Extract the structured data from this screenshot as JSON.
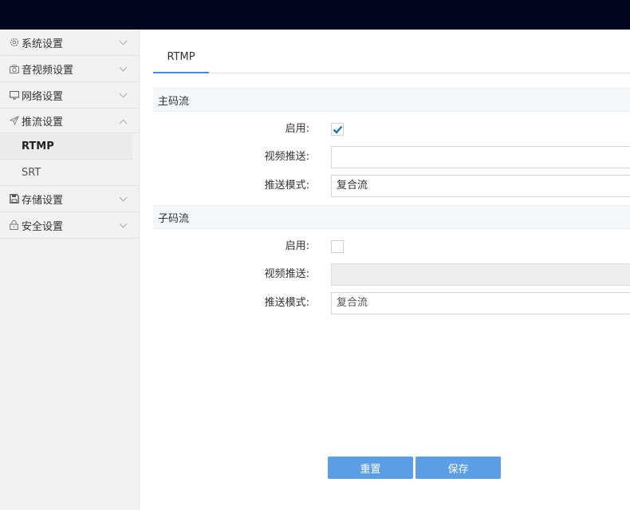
{
  "sidebar": {
    "items": [
      {
        "label": "系统设置",
        "icon": "gear-icon"
      },
      {
        "label": "音视频设置",
        "icon": "camera-icon"
      },
      {
        "label": "网络设置",
        "icon": "monitor-icon"
      },
      {
        "label": "推流设置",
        "icon": "send-icon",
        "expanded": true,
        "children": [
          {
            "label": "RTMP",
            "active": true
          },
          {
            "label": "SRT"
          }
        ]
      },
      {
        "label": "存储设置",
        "icon": "save-icon"
      },
      {
        "label": "安全设置",
        "icon": "lock-icon"
      }
    ]
  },
  "tabs": [
    {
      "label": "RTMP",
      "active": true
    }
  ],
  "main_stream": {
    "title": "主码流",
    "enable_label": "启用:",
    "enabled": true,
    "push_label": "视频推送:",
    "push_value": "",
    "mode_label": "推送模式:",
    "mode_value": "复合流"
  },
  "sub_stream": {
    "title": "子码流",
    "enable_label": "启用:",
    "enabled": false,
    "push_label": "视频推送:",
    "push_value": "",
    "mode_label": "推送模式:",
    "mode_value": "复合流"
  },
  "buttons": {
    "reset_label": "重置",
    "save_label": "保存"
  },
  "colors": {
    "topbar": "#030620",
    "accent": "#3d8de0",
    "button": "#5a9ee6",
    "checkbox": "#1f6fc1"
  }
}
